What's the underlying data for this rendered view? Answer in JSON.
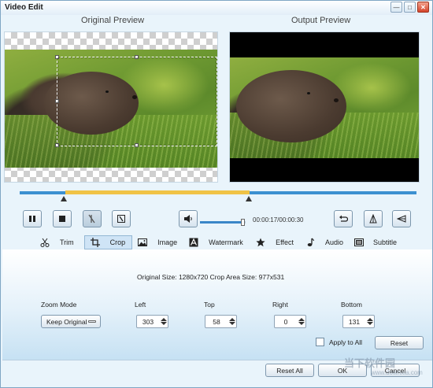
{
  "window": {
    "title": "Video Edit"
  },
  "previews": {
    "original_label": "Original Preview",
    "output_label": "Output Preview"
  },
  "playback": {
    "time": "00:00:17/00:00:30",
    "volume_level": 0.95
  },
  "tabs": [
    {
      "label": "Trim",
      "icon": "scissors-icon",
      "active": false
    },
    {
      "label": "Crop",
      "icon": "crop-icon",
      "active": true
    },
    {
      "label": "Image",
      "icon": "image-icon",
      "active": false
    },
    {
      "label": "Watermark",
      "icon": "watermark-icon",
      "active": false
    },
    {
      "label": "Effect",
      "icon": "star-icon",
      "active": false
    },
    {
      "label": "Audio",
      "icon": "music-note-icon",
      "active": false
    },
    {
      "label": "Subtitle",
      "icon": "subtitle-icon",
      "active": false
    }
  ],
  "crop": {
    "original_size_label": "Original Size:",
    "original_size": "1280x720",
    "crop_area_label": "Crop Area Size:",
    "crop_area": "977x531",
    "zoom_mode_label": "Zoom Mode",
    "zoom_mode_value": "Keep Original",
    "left_label": "Left",
    "left_value": "303",
    "top_label": "Top",
    "top_value": "58",
    "right_label": "Right",
    "right_value": "0",
    "bottom_label": "Bottom",
    "bottom_value": "131",
    "apply_to_all_label": "Apply to All",
    "reset_label": "Reset"
  },
  "footer": {
    "reset_all_label": "Reset All",
    "ok_label": "OK",
    "cancel_label": "Cancel"
  },
  "watermark_text": "当下软件园",
  "watermark_url": "www.downxia.com"
}
